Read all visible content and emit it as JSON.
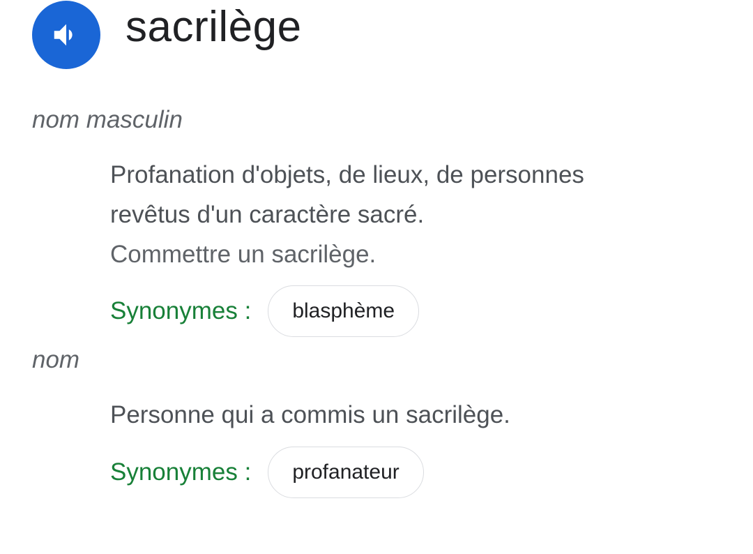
{
  "entry": {
    "word": "sacrilège",
    "audio_icon": "volume-up-icon",
    "accent_color": "#1a66d6"
  },
  "senses": [
    {
      "part_of_speech": "nom masculin",
      "definition": "Profanation d'objets, de lieux, de personnes revêtus d'un caractère sacré.",
      "example": "Commettre un sacrilège.",
      "synonyms_label": "Synonymes :",
      "synonyms": [
        "blasphème"
      ]
    },
    {
      "part_of_speech": "nom",
      "definition": "Personne qui a commis un sacrilège.",
      "synonyms_label": "Synonymes :",
      "synonyms": [
        "profanateur"
      ]
    }
  ],
  "colors": {
    "synonym_label": "#188038",
    "definition_text": "#4d5156"
  }
}
